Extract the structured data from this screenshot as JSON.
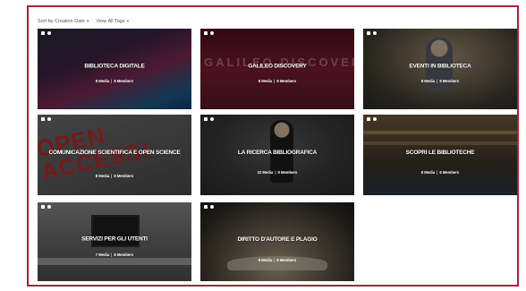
{
  "toolbar": {
    "sort_label": "Sort by Creation Date",
    "view_label": "View All Tags"
  },
  "colors": {
    "frame_border": "#b01e3a",
    "tile_text": "#ffffff"
  },
  "tiles": [
    {
      "title": "BIBLIOTECA DIGITALE",
      "media": "8 Media",
      "members": "8 Members"
    },
    {
      "title": "GALILEO DISCOVERY",
      "media": "8 Media",
      "members": "8 Members"
    },
    {
      "title": "EVENTI IN BIBLIOTECA",
      "media": "8 Media",
      "members": "8 Members"
    },
    {
      "title": "COMUNICAZIONE SCIENTIFICA E OPEN SCIENCE",
      "media": "8 Media",
      "members": "8 Members"
    },
    {
      "title": "LA RICERCA BIBLIOGRAFICA",
      "media": "22 Media",
      "members": "8 Members"
    },
    {
      "title": "SCOPRI LE BIBLIOTECHE",
      "media": "8 Media",
      "members": "8 Members"
    },
    {
      "title": "SERVIZI PER GLI UTENTI",
      "media": "7 Media",
      "members": "8 Members"
    },
    {
      "title": "DIRITTO D'AUTORE E PLAGIO",
      "media": "8 Media",
      "members": "8 Members"
    }
  ],
  "tile_images": {
    "galileo_watermark": "GALILEO DISCOVERY",
    "open_access_sign": "OPEN ACCESS!"
  }
}
